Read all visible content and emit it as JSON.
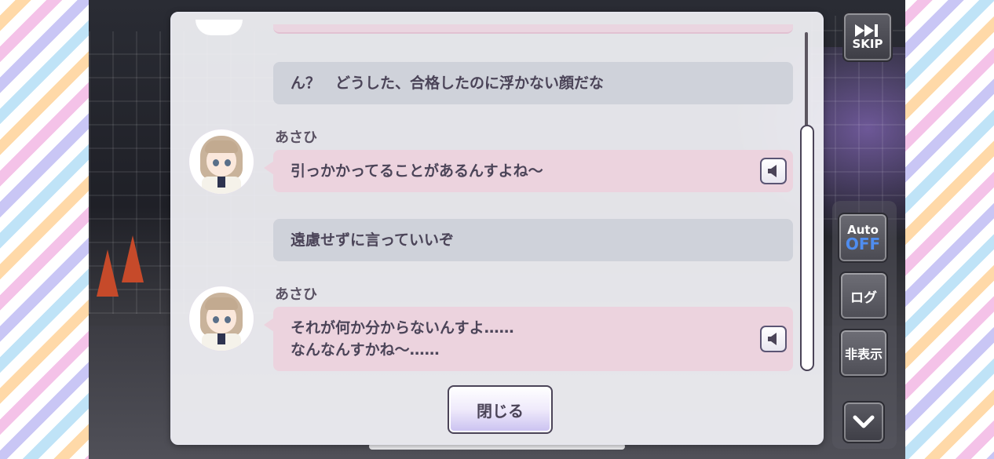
{
  "log": {
    "messages": [
      {
        "type": "player",
        "text": "ん？　どうした、合格したのに浮かない顔だな"
      },
      {
        "type": "chara",
        "speaker": "あさひ",
        "text": "引っかかってることがあるんすよね～"
      },
      {
        "type": "player",
        "text": "遠慮せずに言っていいぞ"
      },
      {
        "type": "chara",
        "speaker": "あさひ",
        "text": "それが何か分からないんすよ……\nなんなんすかね～……"
      }
    ],
    "close_label": "閉じる"
  },
  "controls": {
    "skip_label": "SKIP",
    "auto_label": "Auto",
    "auto_state": "OFF",
    "log_label": "ログ",
    "hide_label": "非表示"
  },
  "icons": {
    "skip": "fast-forward-icon",
    "voice": "speaker-icon",
    "down": "chevron-down-icon",
    "avatar": "asahi-avatar"
  },
  "colors": {
    "player_bubble": "#cfd2da",
    "chara_bubble": "#ecd3de",
    "text": "#4b4458",
    "auto_off": "#4f8df0"
  }
}
